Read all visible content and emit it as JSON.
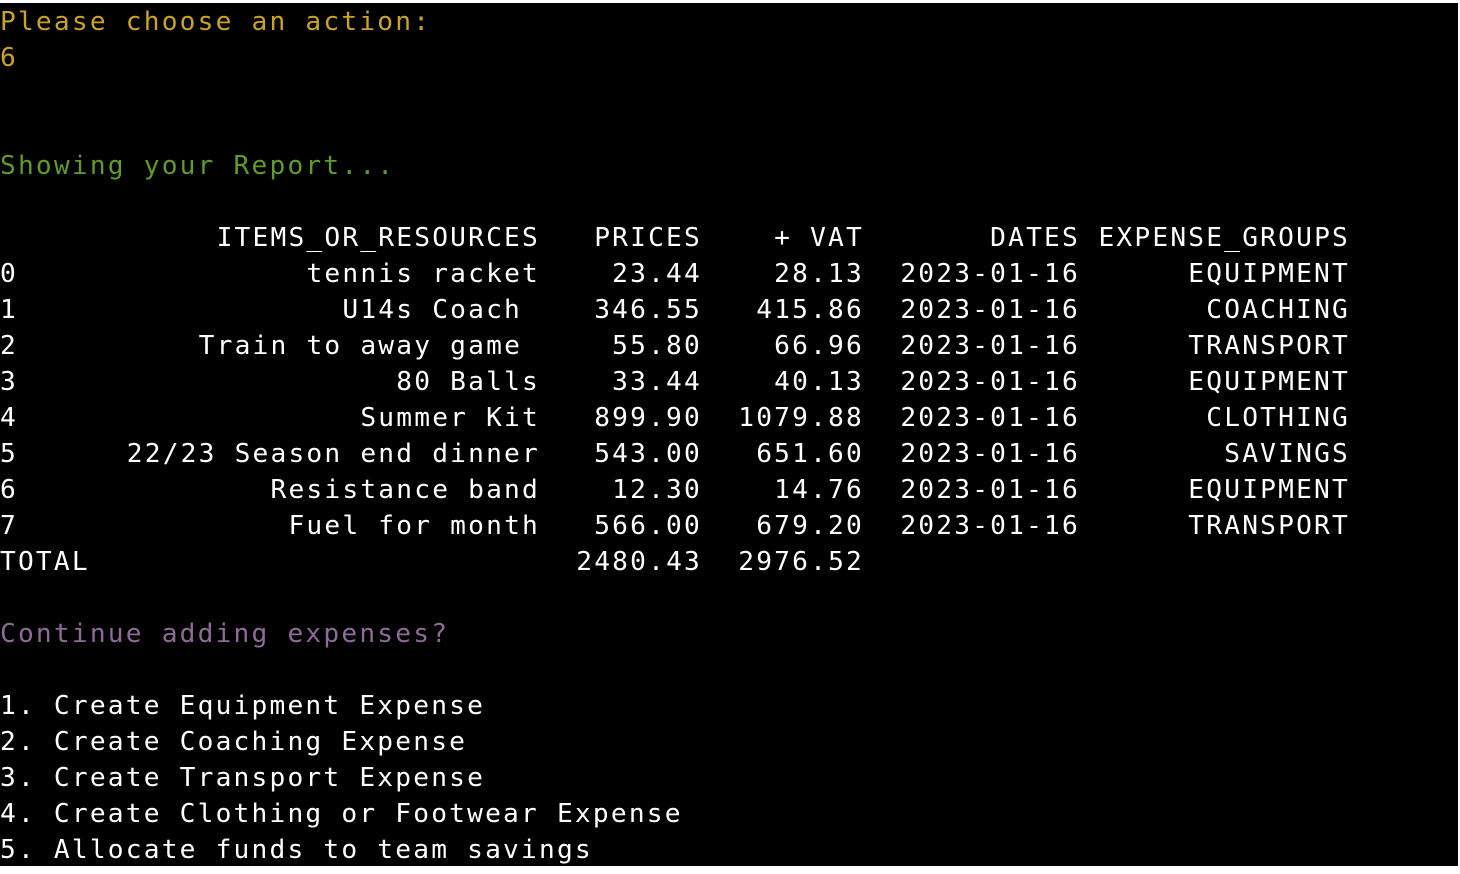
{
  "colors": {
    "background": "#000000",
    "prompt": "#c9a227",
    "status": "#5f9a2a",
    "question": "#8e6a97",
    "text": "#ffffff"
  },
  "prompt": {
    "text": "Please choose an action:",
    "input_value": "6"
  },
  "status_message": "Showing your Report...",
  "report": {
    "headers": {
      "items": "ITEMS_OR_RESOURCES",
      "prices": "PRICES",
      "vat": "+ VAT",
      "dates": "DATES",
      "groups": "EXPENSE_GROUPS"
    },
    "rows": [
      {
        "index": "0",
        "item": "tennis racket",
        "price": "23.44",
        "vat": "28.13",
        "date": "2023-01-16",
        "group": "EQUIPMENT"
      },
      {
        "index": "1",
        "item": "U14s Coach ",
        "price": "346.55",
        "vat": "415.86",
        "date": "2023-01-16",
        "group": "COACHING"
      },
      {
        "index": "2",
        "item": "Train to away game ",
        "price": "55.80",
        "vat": "66.96",
        "date": "2023-01-16",
        "group": "TRANSPORT"
      },
      {
        "index": "3",
        "item": "80 Balls",
        "price": "33.44",
        "vat": "40.13",
        "date": "2023-01-16",
        "group": "EQUIPMENT"
      },
      {
        "index": "4",
        "item": "Summer Kit",
        "price": "899.90",
        "vat": "1079.88",
        "date": "2023-01-16",
        "group": "CLOTHING"
      },
      {
        "index": "5",
        "item": "22/23 Season end dinner",
        "price": "543.00",
        "vat": "651.60",
        "date": "2023-01-16",
        "group": "SAVINGS"
      },
      {
        "index": "6",
        "item": "Resistance band",
        "price": "12.30",
        "vat": "14.76",
        "date": "2023-01-16",
        "group": "EQUIPMENT"
      },
      {
        "index": "7",
        "item": "Fuel for month",
        "price": "566.00",
        "vat": "679.20",
        "date": "2023-01-16",
        "group": "TRANSPORT"
      }
    ],
    "total": {
      "label": "TOTAL",
      "price": "2480.43",
      "vat": "2976.52"
    }
  },
  "continue_question": "Continue adding expenses?",
  "menu": [
    "1. Create Equipment Expense",
    "2. Create Coaching Expense",
    "3. Create Transport Expense",
    "4. Create Clothing or Footwear Expense",
    "5. Allocate funds to team savings"
  ]
}
